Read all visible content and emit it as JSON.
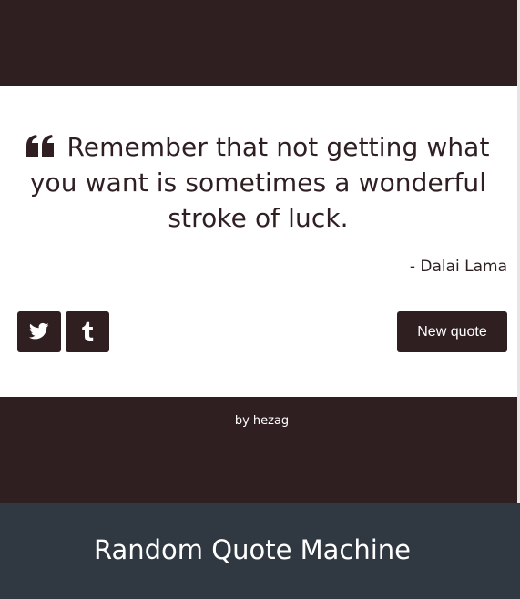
{
  "quote": {
    "text": "Remember that not getting what you want is sometimes a wonderful stroke of luck.",
    "author": "- Dalai Lama",
    "icon": "quote-left-icon"
  },
  "actions": {
    "twitter_icon": "twitter-icon",
    "tumblr_icon": "tumblr-icon",
    "new_quote_label": "New quote"
  },
  "byline": {
    "prefix": "by",
    "author": "hezag"
  },
  "footer": {
    "title": "Random Quote Machine"
  },
  "colors": {
    "primary": "#2f1f21",
    "footer_bg": "#303841",
    "card_bg": "#ffffff"
  }
}
